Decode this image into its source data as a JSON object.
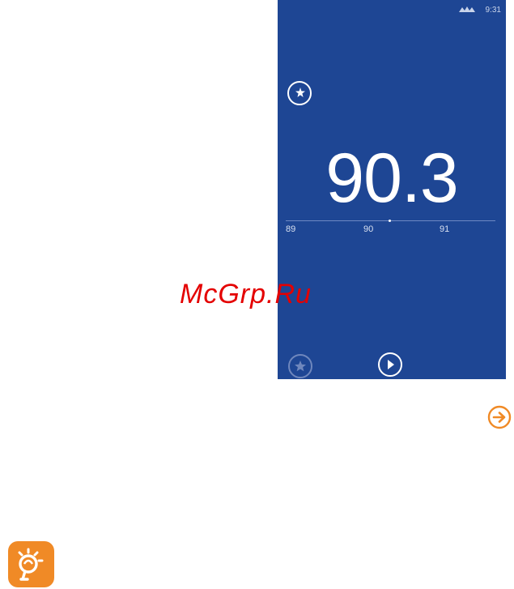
{
  "status_bar": {
    "time": "9:31",
    "signal_icon": "signal-icon",
    "battery_icon": "battery-icon"
  },
  "radio": {
    "frequency": "90.3",
    "tuner": {
      "ticks": [
        "89",
        "90",
        "91"
      ]
    },
    "buttons": {
      "scan_icon": "scan-stations-icon",
      "favorite_icon": "star-icon",
      "play_icon": "play-icon"
    }
  },
  "watermark": "McGrp.Ru",
  "page": {
    "next_icon": "arrow-right-circle-icon",
    "tip_icon": "lightbulb-icon"
  },
  "colors": {
    "screen_bg": "#1e4694",
    "accent": "#f08a26",
    "watermark": "#e40000"
  }
}
